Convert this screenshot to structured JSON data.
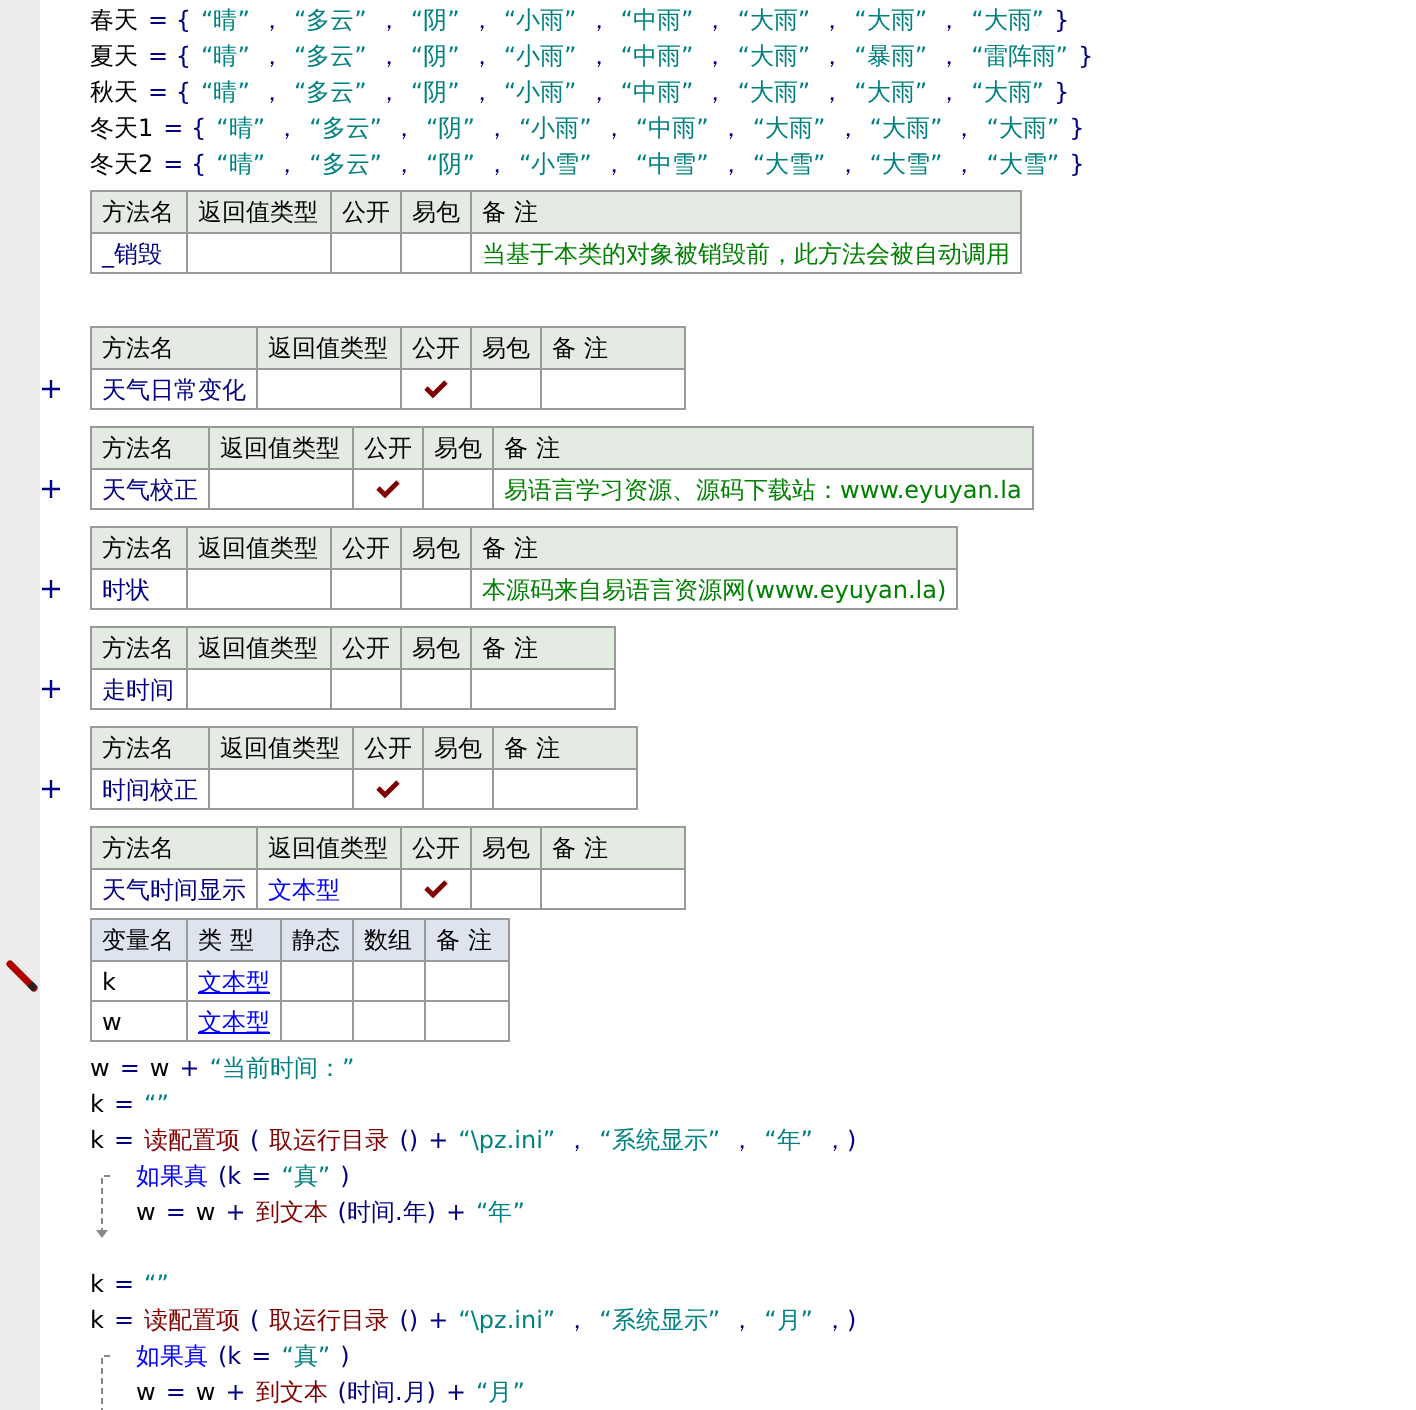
{
  "items": [
    {
      "kind": "code",
      "tokens": [
        {
          "text": "春天",
          "kind": "name"
        },
        {
          "text": "= {",
          "kind": "op"
        },
        {
          "text": "“晴”",
          "kind": "str"
        },
        {
          "text": "，",
          "kind": "op"
        },
        {
          "text": "“多云”",
          "kind": "str"
        },
        {
          "text": "，",
          "kind": "op"
        },
        {
          "text": "“阴”",
          "kind": "str"
        },
        {
          "text": "，",
          "kind": "op"
        },
        {
          "text": "“小雨”",
          "kind": "str"
        },
        {
          "text": "，",
          "kind": "op"
        },
        {
          "text": "“中雨”",
          "kind": "str"
        },
        {
          "text": "，",
          "kind": "op"
        },
        {
          "text": "“大雨”",
          "kind": "str"
        },
        {
          "text": "，",
          "kind": "op"
        },
        {
          "text": "“大雨”",
          "kind": "str"
        },
        {
          "text": "，",
          "kind": "op"
        },
        {
          "text": "“大雨”",
          "kind": "str"
        },
        {
          "text": "}",
          "kind": "op"
        }
      ]
    },
    {
      "kind": "code",
      "tokens": [
        {
          "text": "夏天",
          "kind": "name"
        },
        {
          "text": "= {",
          "kind": "op"
        },
        {
          "text": "“晴”",
          "kind": "str"
        },
        {
          "text": "，",
          "kind": "op"
        },
        {
          "text": "“多云”",
          "kind": "str"
        },
        {
          "text": "，",
          "kind": "op"
        },
        {
          "text": "“阴”",
          "kind": "str"
        },
        {
          "text": "，",
          "kind": "op"
        },
        {
          "text": "“小雨”",
          "kind": "str"
        },
        {
          "text": "，",
          "kind": "op"
        },
        {
          "text": "“中雨”",
          "kind": "str"
        },
        {
          "text": "，",
          "kind": "op"
        },
        {
          "text": "“大雨”",
          "kind": "str"
        },
        {
          "text": "，",
          "kind": "op"
        },
        {
          "text": "“暴雨”",
          "kind": "str"
        },
        {
          "text": "，",
          "kind": "op"
        },
        {
          "text": "“雷阵雨”",
          "kind": "str"
        },
        {
          "text": "}",
          "kind": "op"
        }
      ]
    },
    {
      "kind": "code",
      "tokens": [
        {
          "text": "秋天",
          "kind": "name"
        },
        {
          "text": "= {",
          "kind": "op"
        },
        {
          "text": "“晴”",
          "kind": "str"
        },
        {
          "text": "，",
          "kind": "op"
        },
        {
          "text": "“多云”",
          "kind": "str"
        },
        {
          "text": "，",
          "kind": "op"
        },
        {
          "text": "“阴”",
          "kind": "str"
        },
        {
          "text": "，",
          "kind": "op"
        },
        {
          "text": "“小雨”",
          "kind": "str"
        },
        {
          "text": "，",
          "kind": "op"
        },
        {
          "text": "“中雨”",
          "kind": "str"
        },
        {
          "text": "，",
          "kind": "op"
        },
        {
          "text": "“大雨”",
          "kind": "str"
        },
        {
          "text": "，",
          "kind": "op"
        },
        {
          "text": "“大雨”",
          "kind": "str"
        },
        {
          "text": "，",
          "kind": "op"
        },
        {
          "text": "“大雨”",
          "kind": "str"
        },
        {
          "text": "}",
          "kind": "op"
        }
      ]
    },
    {
      "kind": "code",
      "tokens": [
        {
          "text": "冬天1",
          "kind": "name"
        },
        {
          "text": "= {",
          "kind": "op"
        },
        {
          "text": "“晴”",
          "kind": "str"
        },
        {
          "text": "，",
          "kind": "op"
        },
        {
          "text": "“多云”",
          "kind": "str"
        },
        {
          "text": "，",
          "kind": "op"
        },
        {
          "text": "“阴”",
          "kind": "str"
        },
        {
          "text": "，",
          "kind": "op"
        },
        {
          "text": "“小雨”",
          "kind": "str"
        },
        {
          "text": "，",
          "kind": "op"
        },
        {
          "text": "“中雨”",
          "kind": "str"
        },
        {
          "text": "，",
          "kind": "op"
        },
        {
          "text": "“大雨”",
          "kind": "str"
        },
        {
          "text": "，",
          "kind": "op"
        },
        {
          "text": "“大雨”",
          "kind": "str"
        },
        {
          "text": "，",
          "kind": "op"
        },
        {
          "text": "“大雨”",
          "kind": "str"
        },
        {
          "text": "}",
          "kind": "op"
        }
      ]
    },
    {
      "kind": "code",
      "tokens": [
        {
          "text": "冬天2",
          "kind": "name"
        },
        {
          "text": "= {",
          "kind": "op"
        },
        {
          "text": "“晴”",
          "kind": "str"
        },
        {
          "text": "，",
          "kind": "op"
        },
        {
          "text": "“多云”",
          "kind": "str"
        },
        {
          "text": "，",
          "kind": "op"
        },
        {
          "text": "“阴”",
          "kind": "str"
        },
        {
          "text": "，",
          "kind": "op"
        },
        {
          "text": "“小雪”",
          "kind": "str"
        },
        {
          "text": "，",
          "kind": "op"
        },
        {
          "text": "“中雪”",
          "kind": "str"
        },
        {
          "text": "，",
          "kind": "op"
        },
        {
          "text": "“大雪”",
          "kind": "str"
        },
        {
          "text": "，",
          "kind": "op"
        },
        {
          "text": "“大雪”",
          "kind": "str"
        },
        {
          "text": "，",
          "kind": "op"
        },
        {
          "text": "“大雪”",
          "kind": "str"
        },
        {
          "text": "}",
          "kind": "op"
        }
      ]
    },
    {
      "kind": "method",
      "collapsed": false,
      "columns": [
        "方法名",
        "返回值类型",
        "公开",
        "易包",
        "备 注"
      ],
      "name": "_销毁",
      "public": false,
      "remark": "当基于本类的对象被销毁前，此方法会被自动调用"
    },
    {
      "kind": "blank"
    },
    {
      "kind": "method",
      "collapsed": true,
      "columns": [
        "方法名",
        "返回值类型",
        "公开",
        "易包",
        "备 注"
      ],
      "name": "天气日常变化",
      "public": true
    },
    {
      "kind": "method",
      "collapsed": true,
      "columns": [
        "方法名",
        "返回值类型",
        "公开",
        "易包",
        "备 注"
      ],
      "name": "天气校正",
      "public": true,
      "remark": "易语言学习资源、源码下载站：www.eyuyan.la"
    },
    {
      "kind": "method",
      "collapsed": true,
      "columns": [
        "方法名",
        "返回值类型",
        "公开",
        "易包",
        "备 注"
      ],
      "name": "时状",
      "public": false,
      "remark": "本源码来自易语言资源网(www.eyuyan.la)"
    },
    {
      "kind": "method",
      "collapsed": true,
      "columns": [
        "方法名",
        "返回值类型",
        "公开",
        "易包",
        "备 注"
      ],
      "name": "走时间",
      "public": false
    },
    {
      "kind": "method",
      "collapsed": true,
      "columns": [
        "方法名",
        "返回值类型",
        "公开",
        "易包",
        "备 注"
      ],
      "name": "时间校正",
      "public": true
    },
    {
      "kind": "method",
      "collapsed": false,
      "columns": [
        "方法名",
        "返回值类型",
        "公开",
        "易包",
        "备 注"
      ],
      "name": "天气时间显示",
      "return_type": "文本型",
      "public": true
    },
    {
      "kind": "vars",
      "columns": [
        "变量名",
        "类 型",
        "静态",
        "数组",
        "备 注"
      ],
      "rows": [
        {
          "name": "k",
          "type": "文本型"
        },
        {
          "name": "w",
          "type": "文本型"
        }
      ]
    },
    {
      "kind": "code",
      "tokens": [
        {
          "text": "w",
          "kind": "name"
        },
        {
          "text": "=",
          "kind": "op"
        },
        {
          "text": "w",
          "kind": "name"
        },
        {
          "text": "+",
          "kind": "op"
        },
        {
          "text": "“当前时间：”",
          "kind": "str"
        }
      ]
    },
    {
      "kind": "code",
      "tokens": [
        {
          "text": "k",
          "kind": "name"
        },
        {
          "text": "=",
          "kind": "op"
        },
        {
          "text": "“”",
          "kind": "str"
        }
      ]
    },
    {
      "kind": "code",
      "tokens": [
        {
          "text": "k",
          "kind": "name"
        },
        {
          "text": "=",
          "kind": "op"
        },
        {
          "text": "读配置项",
          "kind": "func"
        },
        {
          "text": "(",
          "kind": "op"
        },
        {
          "text": "取运行目录",
          "kind": "func"
        },
        {
          "text": "()",
          "kind": "op"
        },
        {
          "text": "+",
          "kind": "op"
        },
        {
          "text": "“\\pz.ini”",
          "kind": "str"
        },
        {
          "text": "，",
          "kind": "op"
        },
        {
          "text": "“系统显示”",
          "kind": "str"
        },
        {
          "text": "，",
          "kind": "op"
        },
        {
          "text": "“年”",
          "kind": "str"
        },
        {
          "text": "，)",
          "kind": "op"
        }
      ]
    },
    {
      "kind": "if",
      "tokens": [
        {
          "text": "如果真",
          "kind": "keyword"
        },
        {
          "text": "(k",
          "kind": "op"
        },
        {
          "text": "=",
          "kind": "op"
        },
        {
          "text": "“真”",
          "kind": "str"
        },
        {
          "text": ")",
          "kind": "op"
        }
      ],
      "children": [
        {
          "kind": "code",
          "tokens": [
            {
              "text": "w",
              "kind": "name"
            },
            {
              "text": "=",
              "kind": "op"
            },
            {
              "text": "w",
              "kind": "name"
            },
            {
              "text": "+",
              "kind": "op"
            },
            {
              "text": "到文本",
              "kind": "func"
            },
            {
              "text": "(时间.年)",
              "kind": "op"
            },
            {
              "text": "+",
              "kind": "op"
            },
            {
              "text": "“年”",
              "kind": "str"
            }
          ]
        }
      ]
    },
    {
      "kind": "blank"
    },
    {
      "kind": "code",
      "tokens": [
        {
          "text": "k",
          "kind": "name"
        },
        {
          "text": "=",
          "kind": "op"
        },
        {
          "text": "“”",
          "kind": "str"
        }
      ]
    },
    {
      "kind": "code",
      "tokens": [
        {
          "text": "k",
          "kind": "name"
        },
        {
          "text": "=",
          "kind": "op"
        },
        {
          "text": "读配置项",
          "kind": "func"
        },
        {
          "text": "(",
          "kind": "op"
        },
        {
          "text": "取运行目录",
          "kind": "func"
        },
        {
          "text": "()",
          "kind": "op"
        },
        {
          "text": "+",
          "kind": "op"
        },
        {
          "text": "“\\pz.ini”",
          "kind": "str"
        },
        {
          "text": "，",
          "kind": "op"
        },
        {
          "text": "“系统显示”",
          "kind": "str"
        },
        {
          "text": "，",
          "kind": "op"
        },
        {
          "text": "“月”",
          "kind": "str"
        },
        {
          "text": "，)",
          "kind": "op"
        }
      ]
    },
    {
      "kind": "if",
      "tokens": [
        {
          "text": "如果真",
          "kind": "keyword"
        },
        {
          "text": "(k",
          "kind": "op"
        },
        {
          "text": "=",
          "kind": "op"
        },
        {
          "text": "“真”",
          "kind": "str"
        },
        {
          "text": ")",
          "kind": "op"
        }
      ],
      "children": [
        {
          "kind": "code",
          "tokens": [
            {
              "text": "w",
              "kind": "name"
            },
            {
              "text": "=",
              "kind": "op"
            },
            {
              "text": "w",
              "kind": "name"
            },
            {
              "text": "+",
              "kind": "op"
            },
            {
              "text": "到文本",
              "kind": "func"
            },
            {
              "text": "(时间.月)",
              "kind": "op"
            },
            {
              "text": "+",
              "kind": "op"
            },
            {
              "text": "“月”",
              "kind": "str"
            }
          ]
        }
      ]
    }
  ]
}
